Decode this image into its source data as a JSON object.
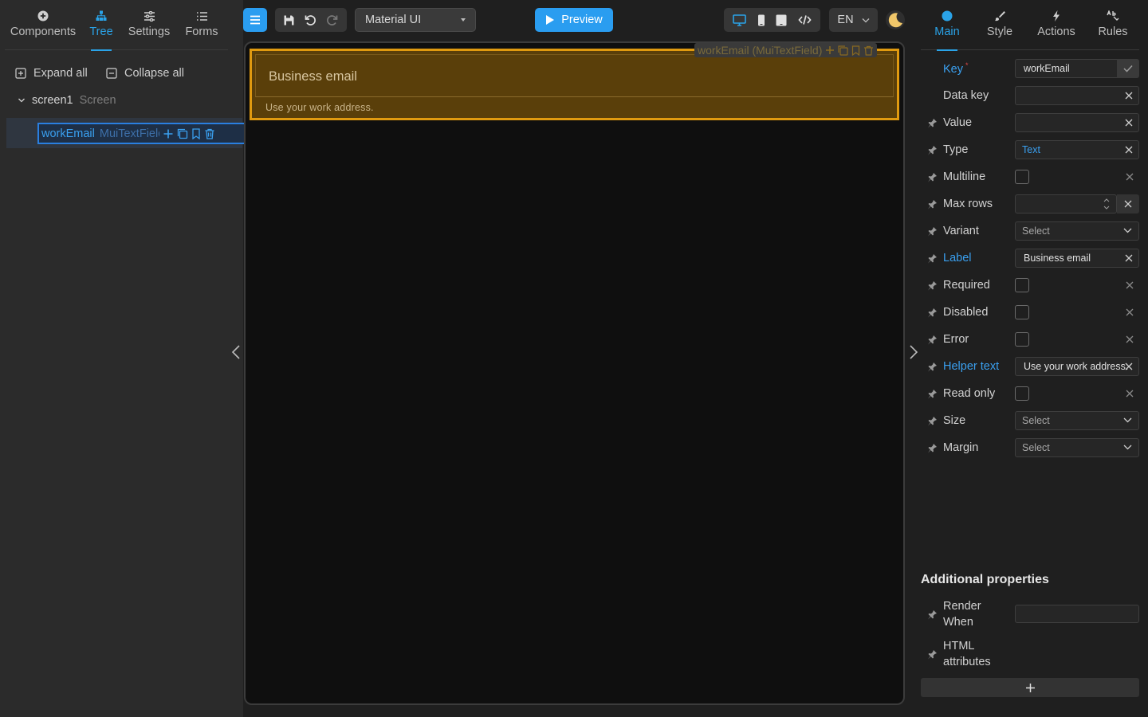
{
  "left_panel": {
    "tabs": [
      {
        "label": "Components",
        "icon": "plus-circle-icon"
      },
      {
        "label": "Tree",
        "icon": "tree-icon"
      },
      {
        "label": "Settings",
        "icon": "sliders-icon"
      },
      {
        "label": "Forms",
        "icon": "list-icon"
      }
    ],
    "active_tab": "Tree",
    "expand_all_label": "Expand all",
    "collapse_all_label": "Collapse all",
    "tree": {
      "root_name": "screen1",
      "root_type": "Screen",
      "selected_node_name": "workEmail",
      "selected_node_type": "MuiTextField"
    }
  },
  "toolbar": {
    "framework_value": "Material UI",
    "preview_label": "Preview",
    "language": "EN"
  },
  "canvas": {
    "component_tag": "workEmail (MuiTextField)",
    "field_label": "Business email",
    "field_helper": "Use your work address."
  },
  "right_panel": {
    "tabs": [
      {
        "label": "Main",
        "icon": "circle-icon"
      },
      {
        "label": "Style",
        "icon": "brush-icon"
      },
      {
        "label": "Actions",
        "icon": "bolt-icon"
      },
      {
        "label": "Rules",
        "icon": "rules-icon"
      }
    ],
    "active_tab": "Main",
    "properties": {
      "key": {
        "label": "Key",
        "value": "workEmail",
        "required_mark": "*"
      },
      "data_key": {
        "label": "Data key",
        "value": ""
      },
      "value": {
        "label": "Value",
        "value": ""
      },
      "type": {
        "label": "Type",
        "value": "Text"
      },
      "multiline": {
        "label": "Multiline",
        "checked": false
      },
      "max_rows": {
        "label": "Max rows",
        "value": ""
      },
      "variant": {
        "label": "Variant",
        "value": "Select"
      },
      "label": {
        "label": "Label",
        "value": "Business email"
      },
      "required": {
        "label": "Required",
        "checked": false
      },
      "disabled": {
        "label": "Disabled",
        "checked": false
      },
      "error": {
        "label": "Error",
        "checked": false
      },
      "helper_text": {
        "label": "Helper text",
        "value": "Use your work address."
      },
      "read_only": {
        "label": "Read only",
        "checked": false
      },
      "size": {
        "label": "Size",
        "value": "Select"
      },
      "margin": {
        "label": "Margin",
        "value": "Select"
      }
    },
    "additional_title": "Additional properties",
    "render_when_label_1": "Render",
    "render_when_label_2": "When",
    "render_when_value": "",
    "html_attr_label_1": "HTML",
    "html_attr_label_2": "attributes"
  },
  "colors": {
    "accent": "#2aa3e8",
    "selection": "#2a7fe0",
    "highlight": "#e09a10"
  }
}
